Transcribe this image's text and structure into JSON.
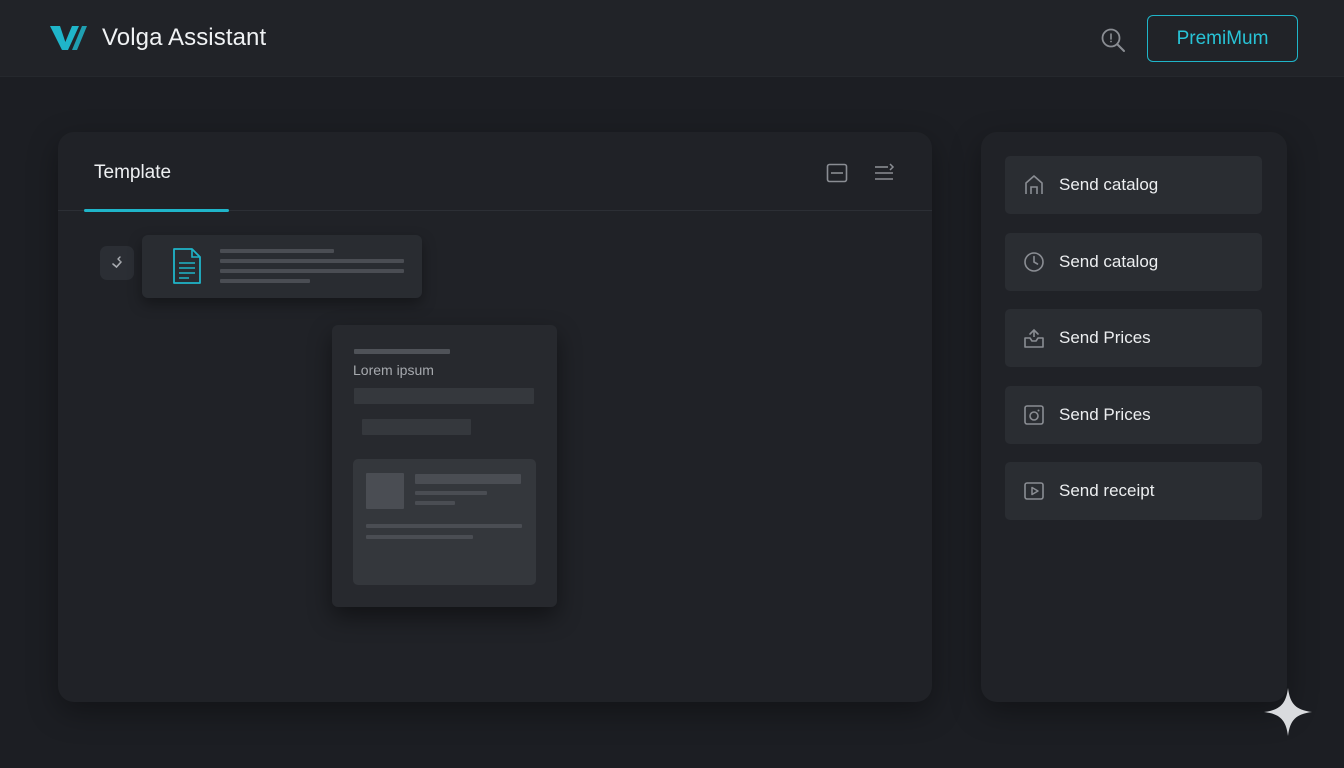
{
  "header": {
    "app_name": "Volga Assistant",
    "premium_label": "PremiMum",
    "accent_color": "#1fb5c9",
    "logo_icon": "v-logo-icon",
    "search_icon": "search-icon"
  },
  "main_panel": {
    "tabs": [
      {
        "label": "Template",
        "active": true
      }
    ],
    "tools": [
      "minimize-icon",
      "list-settings-icon"
    ],
    "document_chip": {
      "icon": "document-icon",
      "handle_icon": "drag-handle-icon"
    },
    "preview_card": {
      "title": "Lorem ipsum"
    }
  },
  "side_panel": {
    "actions": [
      {
        "label": "Send catalog",
        "icon": "home-icon"
      },
      {
        "label": "Send catalog",
        "icon": "clock-icon"
      },
      {
        "label": "Send Prices",
        "icon": "inbox-tray-icon"
      },
      {
        "label": "Send Prices",
        "icon": "camera-square-icon"
      },
      {
        "label": "Send receipt",
        "icon": "play-square-icon"
      }
    ]
  },
  "decor": {
    "corner_icon": "sparkle-icon"
  }
}
